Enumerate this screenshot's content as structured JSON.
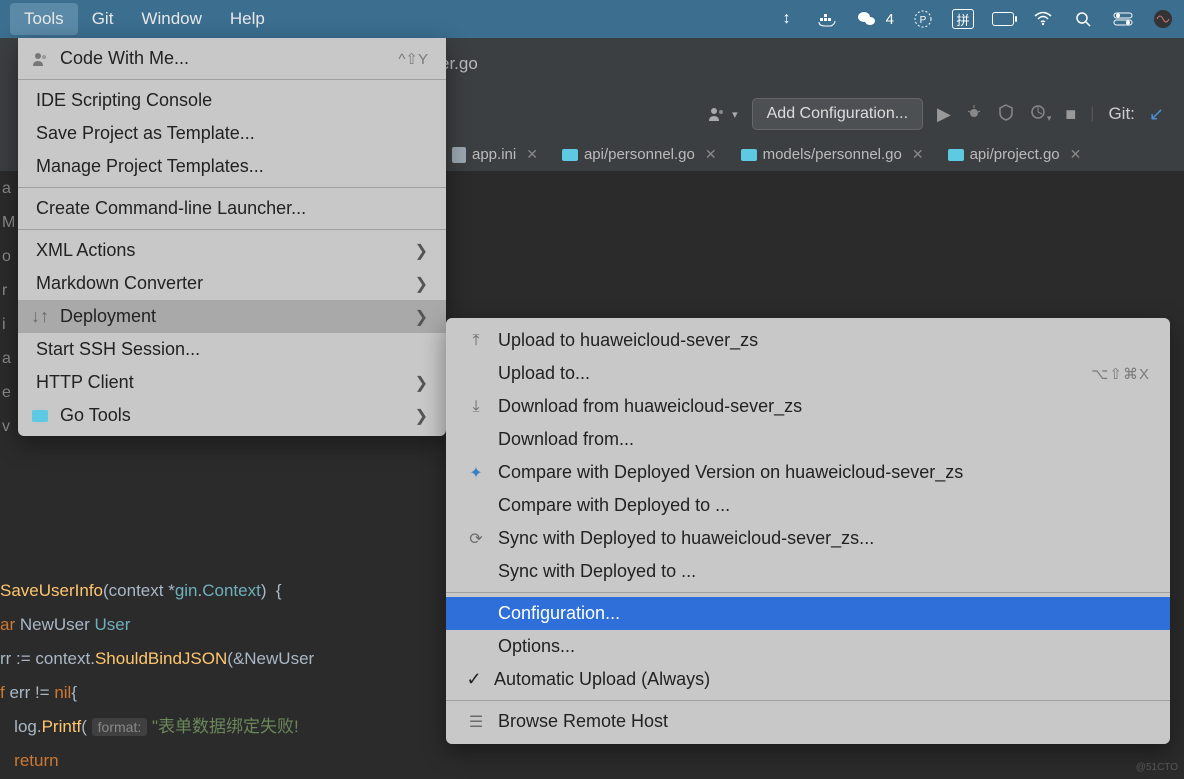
{
  "menubar": {
    "items": [
      "Tools",
      "Git",
      "Window",
      "Help"
    ],
    "wechat_count": "4"
  },
  "breadcrumb": {
    "file": "er.go"
  },
  "toolbar": {
    "add_config": "Add Configuration...",
    "git_label": "Git:"
  },
  "tabs": [
    {
      "label": "app.ini",
      "kind": "ini"
    },
    {
      "label": "api/personnel.go",
      "kind": "go"
    },
    {
      "label": "models/personnel.go",
      "kind": "go"
    },
    {
      "label": "api/project.go",
      "kind": "go"
    }
  ],
  "gutter": [
    "a",
    "M",
    "o",
    "r",
    "i",
    "a",
    "e",
    "v"
  ],
  "code": {
    "l1a": "SaveUserInfo",
    "l1b": "(context *",
    "l1c": "gin",
    "l1d": ".",
    "l1e": "Context",
    "l1f": ")  {",
    "l2a": "ar ",
    "l2b": "NewUser ",
    "l2c": "User",
    "l3a": "rr := ",
    "l3b": "context",
    "l3c": ".",
    "l3d": "ShouldBindJSON",
    "l3e": "(&",
    "l3f": "NewUser",
    "l4a": "f ",
    "l4b": "err != ",
    "l4c": "nil",
    "l4d": "{",
    "l5a": "   log.",
    "l5b": "Printf",
    "l5c": "( ",
    "l5hint": "format:",
    "l5d": " ",
    "l5e": "\"表单数据绑定失败!",
    "l6a": "   return"
  },
  "tools_menu": {
    "code_with_me": "Code With Me...",
    "code_with_me_shortcut": "^⇧Y",
    "ide_scripting": "IDE Scripting Console",
    "save_template": "Save Project as Template...",
    "manage_templates": "Manage Project Templates...",
    "create_launcher": "Create Command-line Launcher...",
    "xml_actions": "XML Actions",
    "markdown_conv": "Markdown Converter",
    "deployment": "Deployment",
    "start_ssh": "Start SSH Session...",
    "http_client": "HTTP Client",
    "go_tools": "Go Tools"
  },
  "deploy_menu": {
    "upload_to_hw": "Upload to huaweicloud-sever_zs",
    "upload_to": "Upload to...",
    "upload_to_shortcut": "⌥⇧⌘X",
    "download_from_hw": "Download from huaweicloud-sever_zs",
    "download_from": "Download from...",
    "compare_hw": "Compare with Deployed Version on huaweicloud-sever_zs",
    "compare_to": "Compare with Deployed to ...",
    "sync_hw": "Sync with Deployed to huaweicloud-sever_zs...",
    "sync_to": "Sync with Deployed to ...",
    "configuration": "Configuration...",
    "options": "Options...",
    "auto_upload": "Automatic Upload (Always)",
    "browse_remote": "Browse Remote Host"
  }
}
